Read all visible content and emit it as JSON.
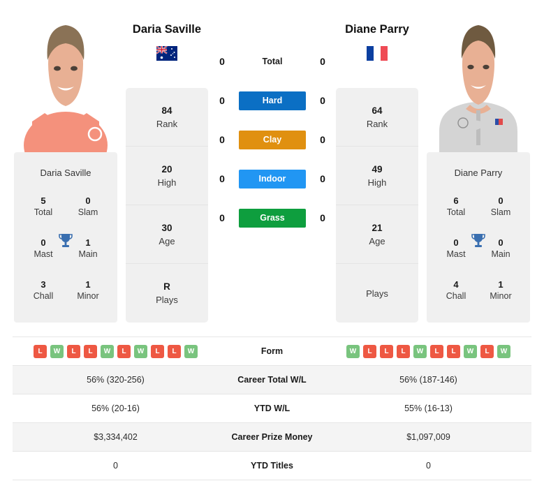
{
  "players": {
    "left": {
      "name": "Daria Saville",
      "flag": "australia-flag",
      "nameplate": "Daria Saville",
      "titles": {
        "total": "5",
        "total_label": "Total",
        "slam": "0",
        "slam_label": "Slam",
        "mast": "0",
        "mast_label": "Mast",
        "main": "1",
        "main_label": "Main",
        "chall": "3",
        "chall_label": "Chall",
        "minor": "1",
        "minor_label": "Minor"
      },
      "vitals": [
        {
          "value": "84",
          "label": "Rank"
        },
        {
          "value": "20",
          "label": "High"
        },
        {
          "value": "30",
          "label": "Age"
        },
        {
          "value": "R",
          "label": "Plays"
        }
      ],
      "form": [
        "L",
        "W",
        "L",
        "L",
        "W",
        "L",
        "W",
        "L",
        "L",
        "W"
      ],
      "career_total_wl": "56% (320-256)",
      "ytd_wl": "56% (20-16)",
      "career_prize_money": "$3,334,402",
      "ytd_titles": "0"
    },
    "right": {
      "name": "Diane Parry",
      "flag": "france-flag",
      "nameplate": "Diane Parry",
      "titles": {
        "total": "6",
        "total_label": "Total",
        "slam": "0",
        "slam_label": "Slam",
        "mast": "0",
        "mast_label": "Mast",
        "main": "0",
        "main_label": "Main",
        "chall": "4",
        "chall_label": "Chall",
        "minor": "1",
        "minor_label": "Minor"
      },
      "vitals": [
        {
          "value": "64",
          "label": "Rank"
        },
        {
          "value": "49",
          "label": "High"
        },
        {
          "value": "21",
          "label": "Age"
        },
        {
          "value": "",
          "label": "Plays"
        }
      ],
      "form": [
        "W",
        "L",
        "L",
        "L",
        "W",
        "L",
        "L",
        "W",
        "L",
        "W"
      ],
      "career_total_wl": "56% (187-146)",
      "ytd_wl": "55% (16-13)",
      "career_prize_money": "$1,097,009",
      "ytd_titles": "0"
    }
  },
  "h2h": [
    {
      "label": "Total",
      "left": "0",
      "right": "0",
      "color": "",
      "type": "total"
    },
    {
      "label": "Hard",
      "left": "0",
      "right": "0",
      "color": "#0b6fc4",
      "type": "surface"
    },
    {
      "label": "Clay",
      "left": "0",
      "right": "0",
      "color": "#e09010",
      "type": "surface"
    },
    {
      "label": "Indoor",
      "left": "0",
      "right": "0",
      "color": "#2196f3",
      "type": "surface"
    },
    {
      "label": "Grass",
      "left": "0",
      "right": "0",
      "color": "#0e9e3e",
      "type": "surface"
    }
  ],
  "stats_rows": [
    {
      "label": "Form",
      "left": "",
      "right": "",
      "kind": "form"
    },
    {
      "label": "Career Total W/L",
      "left": "56% (320-256)",
      "right": "56% (187-146)",
      "kind": "text"
    },
    {
      "label": "YTD W/L",
      "left": "56% (20-16)",
      "right": "55% (16-13)",
      "kind": "text"
    },
    {
      "label": "Career Prize Money",
      "left": "$3,334,402",
      "right": "$1,097,009",
      "kind": "text"
    },
    {
      "label": "YTD Titles",
      "left": "0",
      "right": "0",
      "kind": "text"
    }
  ],
  "colors": {
    "win": "#79c47e",
    "loss": "#ee5843",
    "trophy": "#3a6fb0",
    "panel": "#f0f0f0"
  }
}
